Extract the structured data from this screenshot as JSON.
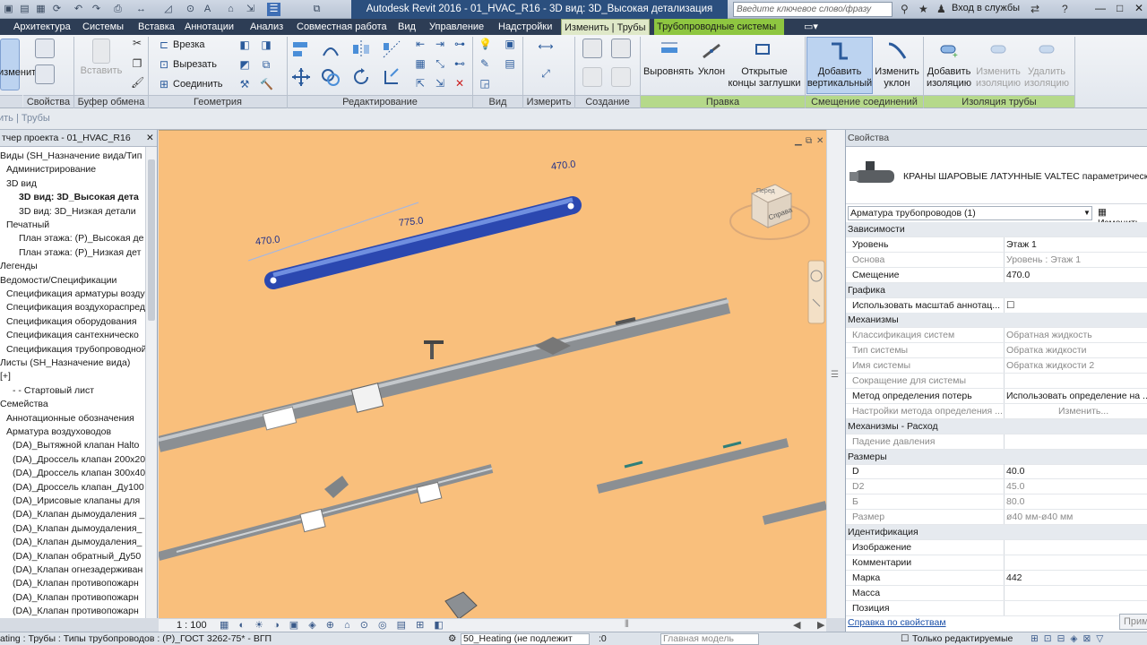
{
  "title_bar": {
    "title": "Autodesk Revit 2016 -    01_HVAC_R16 - 3D вид: 3D_Высокая детализация",
    "search_placeholder": "Введите ключевое слово/фразу",
    "signin": "Вход в службы"
  },
  "menu_tabs": [
    "Архитектура",
    "Системы",
    "Вставка",
    "Аннотации",
    "Анализ",
    "Совместная работа",
    "Вид",
    "Управление",
    "Надстройки",
    "Изменить | Трубы",
    "Трубопроводные системы"
  ],
  "ribbon": {
    "modify_label": "изменить",
    "paste_label": "Вставить",
    "geometry_items": [
      "Врезка",
      "Вырезать",
      "Соединить"
    ],
    "panels": {
      "properties": "Свойства",
      "clipboard": "Буфер обмена",
      "geometry": "Геометрия",
      "edit": "Редактирование",
      "view": "Вид",
      "measure": "Измерить",
      "create": "Создание",
      "edit_ctx": "Правка",
      "offset": "Смещение соединений",
      "insulation": "Изоляция трубы"
    },
    "buttons": {
      "align": "Выровнять",
      "slope": "Уклон",
      "open_ends": "Открытые\nконцы заглушки",
      "add_vertical": "Добавить\nвертикальный",
      "change_slope": "Изменить\nуклон",
      "add_insulation": "Добавить\nизоляцию",
      "edit_insulation": "Изменить\nизоляцию",
      "remove_insulation": "Удалить\nизоляцию"
    }
  },
  "options_bar": {
    "left_label": "ить | Трубы"
  },
  "browser": {
    "title": "тчер проекта - 01_HVAC_R16",
    "rows": [
      {
        "text": "Виды (SH_Назначение вида/Тип",
        "indent": 0,
        "bold": false
      },
      {
        "text": "Администрирование",
        "indent": 1,
        "bold": false
      },
      {
        "text": "3D вид",
        "indent": 1,
        "bold": false
      },
      {
        "text": "3D вид: 3D_Высокая дета",
        "indent": 3,
        "bold": true
      },
      {
        "text": "3D вид: 3D_Низкая детали",
        "indent": 3,
        "bold": false
      },
      {
        "text": "Печатный",
        "indent": 1,
        "bold": false
      },
      {
        "text": "План этажа: (Р)_Высокая де",
        "indent": 3,
        "bold": false
      },
      {
        "text": "План этажа: (Р)_Низкая дет",
        "indent": 3,
        "bold": false
      },
      {
        "text": "Легенды",
        "indent": 0,
        "bold": false
      },
      {
        "text": "Ведомости/Спецификации",
        "indent": 0,
        "bold": false
      },
      {
        "text": "Спецификация арматуры воздух",
        "indent": 1,
        "bold": false
      },
      {
        "text": "Спецификация воздухораспреде",
        "indent": 1,
        "bold": false
      },
      {
        "text": "Спецификация оборудования",
        "indent": 1,
        "bold": false
      },
      {
        "text": "Спецификация сантехническо",
        "indent": 1,
        "bold": false
      },
      {
        "text": "Спецификация трубопроводной",
        "indent": 1,
        "bold": false
      },
      {
        "text": "Листы (SH_Назначение вида)",
        "indent": 0,
        "bold": false
      },
      {
        "text": "[+]",
        "indent": 0,
        "bold": false
      },
      {
        "text": "- - Стартовый лист",
        "indent": 2,
        "bold": false
      },
      {
        "text": "Семейства",
        "indent": 0,
        "bold": false
      },
      {
        "text": "Аннотационные обозначения",
        "indent": 1,
        "bold": false
      },
      {
        "text": "Арматура воздуховодов",
        "indent": 1,
        "bold": false
      },
      {
        "text": "(DA)_Вытяжной клапан Halto",
        "indent": 2,
        "bold": false
      },
      {
        "text": "(DA)_Дроссель клапан 200x20",
        "indent": 2,
        "bold": false
      },
      {
        "text": "(DA)_Дроссель клапан 300x40",
        "indent": 2,
        "bold": false
      },
      {
        "text": "(DA)_Дроссель клапан_Ду100",
        "indent": 2,
        "bold": false
      },
      {
        "text": "(DA)_Ирисовые клапаны для",
        "indent": 2,
        "bold": false
      },
      {
        "text": "(DA)_Клапан дымоудаления _",
        "indent": 2,
        "bold": false
      },
      {
        "text": "(DA)_Клапан дымоудаления_",
        "indent": 2,
        "bold": false
      },
      {
        "text": "(DA)_Клапан дымоудаления_",
        "indent": 2,
        "bold": false
      },
      {
        "text": "(DA)_Клапан обратный_Ду50",
        "indent": 2,
        "bold": false
      },
      {
        "text": "(DA)_Клапан огнезадерживан",
        "indent": 2,
        "bold": false
      },
      {
        "text": "(DA)_Клапан противопожарн",
        "indent": 2,
        "bold": false
      },
      {
        "text": "(DA)_Клапан противопожарн",
        "indent": 2,
        "bold": false
      },
      {
        "text": "(DA)_Клапан противопожарн",
        "indent": 2,
        "bold": false
      }
    ]
  },
  "viewport": {
    "dims": [
      "470.0",
      "775.0",
      "470.0"
    ],
    "scale": "1 : 100",
    "viewcube_top": "Перед",
    "viewcube_front": "Справа"
  },
  "properties": {
    "title": "Свойства",
    "family_name": "КРАНЫ ШАРОВЫЕ ЛАТУННЫЕ VALTEC параметрическое",
    "selector": "Арматура трубопроводов (1)",
    "edit_type": "Изменить",
    "rows": [
      {
        "k": "Зависимости",
        "v": "",
        "type": "grp"
      },
      {
        "k": "Уровень",
        "v": "Этаж 1",
        "type": "row"
      },
      {
        "k": "Основа",
        "v": "Уровень : Этаж 1",
        "type": "dim"
      },
      {
        "k": "Смещение",
        "v": "470.0",
        "type": "row"
      },
      {
        "k": "Графика",
        "v": "",
        "type": "grp"
      },
      {
        "k": "Использовать масштаб аннотац...",
        "v": "☐",
        "type": "row"
      },
      {
        "k": "Механизмы",
        "v": "",
        "type": "grp"
      },
      {
        "k": "Классификация систем",
        "v": "Обратная жидкость",
        "type": "dim"
      },
      {
        "k": "Тип системы",
        "v": "Обратка жидкости",
        "type": "dim"
      },
      {
        "k": "Имя системы",
        "v": "Обратка жидкости 2",
        "type": "dim"
      },
      {
        "k": "Сокращение для системы",
        "v": "",
        "type": "dim"
      },
      {
        "k": "Метод определения потерь",
        "v": "Использовать определение на ...",
        "type": "row"
      },
      {
        "k": "Настройки метода определения ...",
        "v": "Изменить...",
        "type": "dim"
      },
      {
        "k": "Механизмы - Расход",
        "v": "",
        "type": "grp"
      },
      {
        "k": "Падение давления",
        "v": "",
        "type": "dim"
      },
      {
        "k": "Размеры",
        "v": "",
        "type": "grp"
      },
      {
        "k": "D",
        "v": "40.0",
        "type": "row"
      },
      {
        "k": "D2",
        "v": "45.0",
        "type": "dim"
      },
      {
        "k": "Б",
        "v": "80.0",
        "type": "dim"
      },
      {
        "k": "Размер",
        "v": "ø40 мм-ø40 мм",
        "type": "dim"
      },
      {
        "k": "Идентификация",
        "v": "",
        "type": "grp"
      },
      {
        "k": "Изображение",
        "v": "",
        "type": "row"
      },
      {
        "k": "Комментарии",
        "v": "",
        "type": "row"
      },
      {
        "k": "Марка",
        "v": "442",
        "type": "row"
      },
      {
        "k": "Масса",
        "v": "",
        "type": "row"
      },
      {
        "k": "Позиция",
        "v": "",
        "type": "row"
      }
    ],
    "help_link": "Справка по свойствам",
    "apply": "Приме"
  },
  "status_bar": {
    "left": "ating : Трубы : Типы трубопроводов : (Р)_ГОСТ 3262-75* - ВГП",
    "workset": "50_Heating (не подлежит",
    "counter": ":0",
    "model": "Главная модель",
    "editable": "Только редактируемые"
  },
  "colors": {
    "viewport_bg": "#f9bf7c",
    "selected_pipe": "#3a5fcc",
    "ribbon_ctx": "#8ec640",
    "title_bg": "#2b4f7e"
  }
}
